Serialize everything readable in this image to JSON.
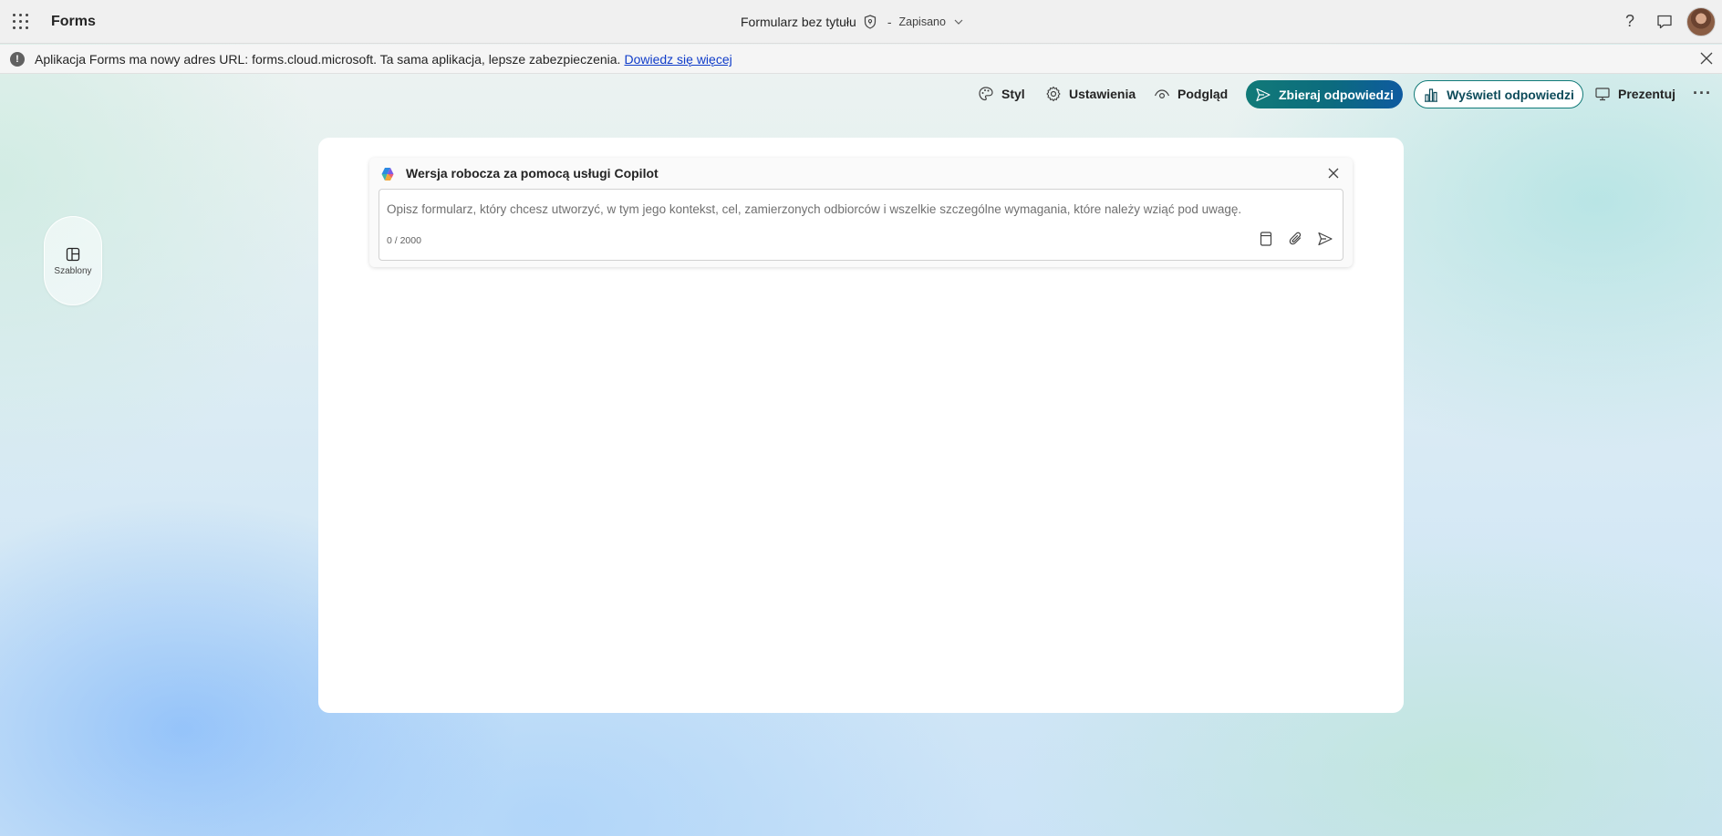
{
  "app": {
    "name": "Forms"
  },
  "header": {
    "form_title": "Formularz bez tytułu",
    "separator": "-",
    "save_status": "Zapisano",
    "help_label": "?"
  },
  "notice": {
    "text": "Aplikacja Forms ma nowy adres URL: forms.cloud.microsoft. Ta sama aplikacja, lepsze zabezpieczenia.",
    "link": "Dowiedz się więcej",
    "icon_glyph": "!"
  },
  "toolbar": {
    "style_label": "Styl",
    "settings_label": "Ustawienia",
    "preview_label": "Podgląd",
    "collect_label": "Zbieraj odpowiedzi",
    "view_label": "Wyświetl odpowiedzi",
    "present_label": "Prezentuj",
    "more_label": "···"
  },
  "sidebar": {
    "templates_label": "Szablony"
  },
  "copilot": {
    "title": "Wersja robocza za pomocą usługi Copilot",
    "placeholder": "Opisz formularz, który chcesz utworzyć, w tym jego kontekst, cel, zamierzonych odbiorców i wszelkie szczególne wymagania, które należy wziąć pod uwagę.",
    "counter": "0 / 2000"
  },
  "colors": {
    "accent_teal": "#117a78",
    "accent_blue": "#0e5aa0",
    "link": "#0f3cc9"
  }
}
